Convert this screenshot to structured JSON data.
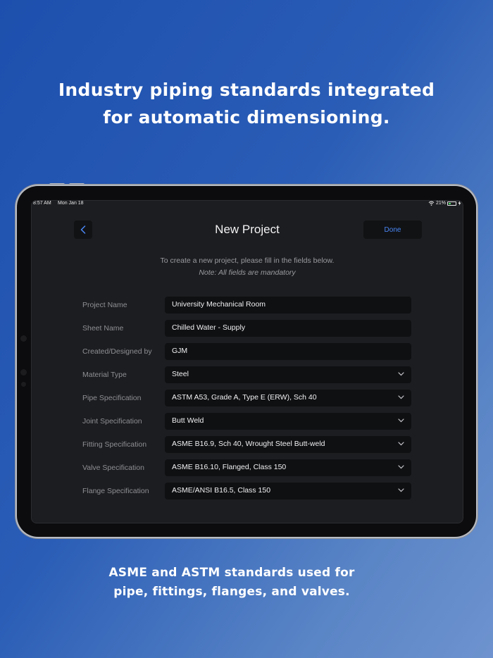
{
  "headline": {
    "line1": "Industry piping standards integrated",
    "line2": "for automatic dimensioning."
  },
  "footline": {
    "line1": "ASME and ASTM standards used for",
    "line2": "pipe, fittings, flanges, and valves."
  },
  "statusbar": {
    "time": "8:57 AM",
    "date": "Mon Jan 18",
    "battery": "21%",
    "icons": [
      "wifi-icon",
      "battery-icon",
      "charging-bolt-icon"
    ]
  },
  "navbar": {
    "back_icon": "chevron-left-icon",
    "title": "New Project",
    "done_label": "Done"
  },
  "instructions": {
    "text": "To create a new project, please fill in the fields below.",
    "note": "Note: All fields are mandatory"
  },
  "fields": [
    {
      "label": "Project Name",
      "value": "University Mechanical Room",
      "dropdown": false
    },
    {
      "label": "Sheet Name",
      "value": "Chilled Water - Supply",
      "dropdown": false
    },
    {
      "label": "Created/Designed by",
      "value": "GJM",
      "dropdown": false
    },
    {
      "label": "Material Type",
      "value": "Steel",
      "dropdown": true
    },
    {
      "label": "Pipe Specification",
      "value": "ASTM A53, Grade A, Type E (ERW), Sch 40",
      "dropdown": true
    },
    {
      "label": "Joint Specification",
      "value": "Butt Weld",
      "dropdown": true
    },
    {
      "label": "Fitting Specification",
      "value": "ASME B16.9, Sch 40, Wrought Steel Butt-weld",
      "dropdown": true
    },
    {
      "label": "Valve Specification",
      "value": "ASME B16.10, Flanged, Class 150",
      "dropdown": true
    },
    {
      "label": "Flange Specification",
      "value": "ASME/ANSI B16.5, Class 150",
      "dropdown": true
    }
  ],
  "colors": {
    "accent": "#4a87f5",
    "background_start": "#1d4fae",
    "background_end": "#6e93cf",
    "screen_bg": "#1c1d20",
    "field_bg": "#0f1012"
  }
}
